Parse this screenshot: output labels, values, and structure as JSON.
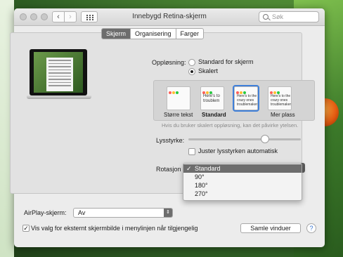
{
  "window": {
    "title": "Innebygd Retina-skjerm",
    "search_placeholder": "Søk"
  },
  "tabs": [
    {
      "label": "Skjerm",
      "active": true
    },
    {
      "label": "Organisering",
      "active": false
    },
    {
      "label": "Farger",
      "active": false
    }
  ],
  "laptop_doc_text": "Here's to troubles",
  "resolution": {
    "label": "Oppløsning:",
    "options": [
      {
        "label": "Standard for skjerm",
        "selected": false
      },
      {
        "label": "Skalert",
        "selected": true
      }
    ]
  },
  "scaled_options": [
    {
      "label": "Større tekst",
      "preview": "",
      "selected": false
    },
    {
      "label": "Standard",
      "preview": "Here's to troublem",
      "selected": false
    },
    {
      "label": "",
      "preview": "Here's to the crazy ones troublemakers",
      "selected": true
    },
    {
      "label": "Mer plass",
      "preview": "Here's to the crazy ones troublemakers",
      "selected": false
    }
  ],
  "hint": "Hvis du bruker skalert oppløsning, kan det påvirke ytelsen.",
  "brightness": {
    "label": "Lysstyrke:",
    "value": 0.68,
    "auto_label": "Juster lysstyrken automatisk",
    "auto_checked": false
  },
  "rotation": {
    "label": "Rotasjon",
    "options": [
      "Standard",
      "90°",
      "180°",
      "270°"
    ],
    "selected": "Standard",
    "checkmark": "✓"
  },
  "airplay": {
    "label": "AirPlay-skjerm:",
    "value": "Av"
  },
  "mirror_option": {
    "label": "Vis valg for eksternt skjermbilde i menylinjen når tilgjengelig",
    "checked": true,
    "check_glyph": "✓"
  },
  "gather_windows_label": "Samle vinduer",
  "help_label": "?",
  "colors": {
    "traffic": "#c8c8c8",
    "selection": "#3f7fd9",
    "active_tab": "#6d6d6d"
  }
}
